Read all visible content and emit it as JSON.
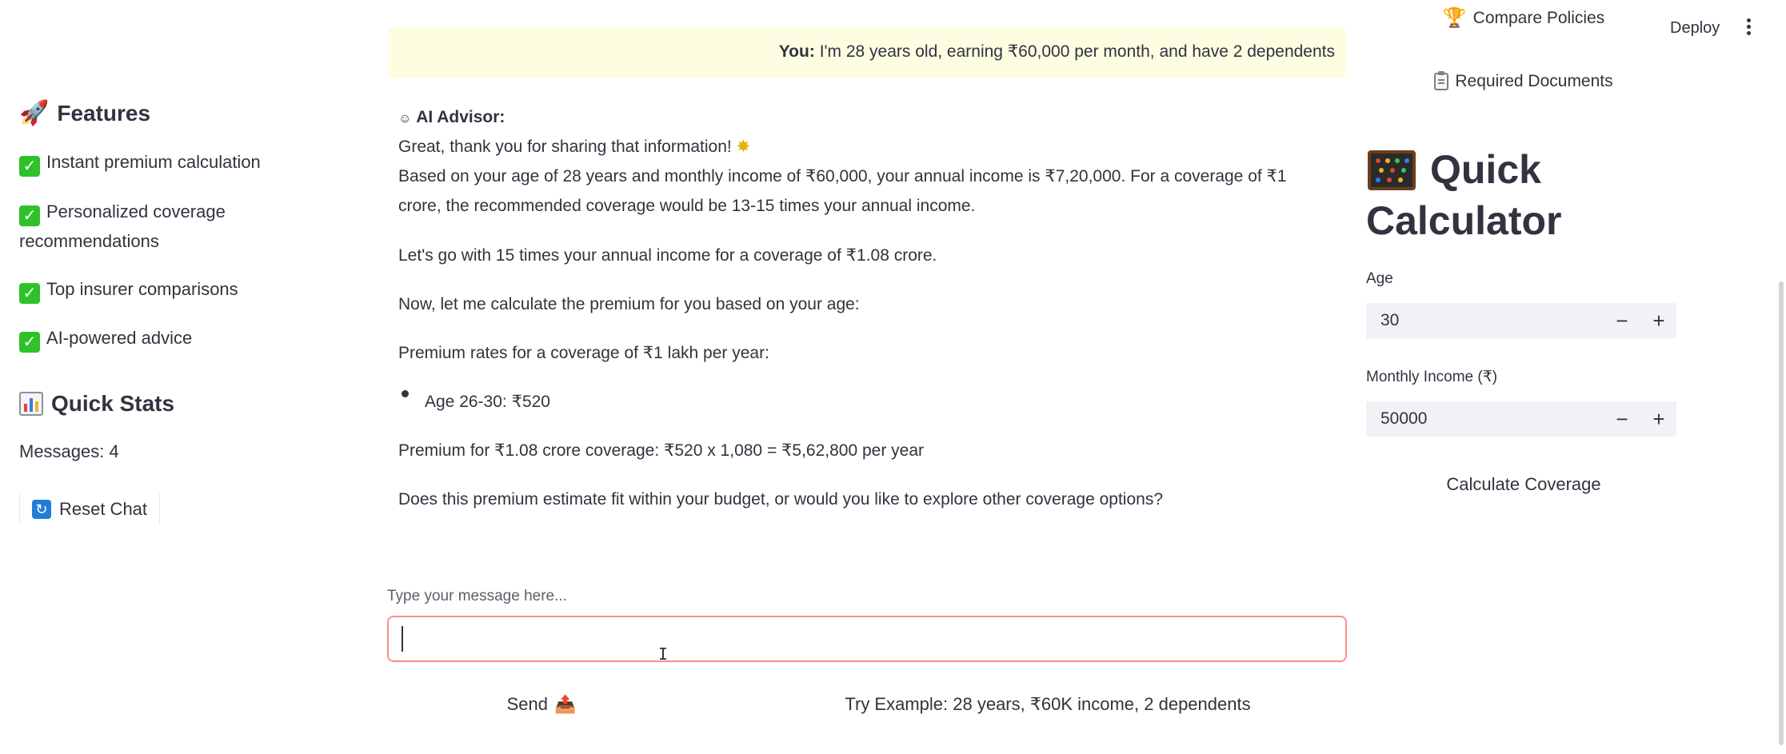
{
  "header": {
    "deploy_label": "Deploy"
  },
  "sidebar": {
    "features_heading": "Features",
    "features": [
      "Instant premium calculation",
      "Personalized coverage recommendations",
      "Top insurer comparisons",
      "AI-powered advice"
    ],
    "stats_heading": "Quick Stats",
    "messages_text": "Messages: 4",
    "reset_label": "Reset Chat"
  },
  "chat": {
    "user_prefix": "You:",
    "user_text": "I'm 28 years old, earning ₹60,000 per month, and have 2 dependents",
    "ai_icon": "☺",
    "ai_name": "AI Advisor:",
    "ai_greeting": "Great, thank you for sharing that information!",
    "ai_p1": "Based on your age of 28 years and monthly income of ₹60,000, your annual income is ₹7,20,000. For a coverage of ₹1 crore, the recommended coverage would be 13-15 times your annual income.",
    "ai_p2": "Let's go with 15 times your annual income for a coverage of ₹1.08 crore.",
    "ai_p3": "Now, let me calculate the premium for you based on your age:",
    "ai_p4": "Premium rates for a coverage of ₹1 lakh per year:",
    "ai_bullet": "Age 26-30: ₹520",
    "ai_p5": "Premium for ₹1.08 crore coverage: ₹520 x 1,080 = ₹5,62,800 per year",
    "ai_p6": "Does this premium estimate fit within your budget, or would you like to explore other coverage options?",
    "input_label": "Type your message here...",
    "input_value": "",
    "send_label": "Send",
    "example_label": "Try Example: 28 years, ₹60K income, 2 dependents"
  },
  "right": {
    "compare_label": "Compare Policies",
    "docs_label": "Required Documents",
    "calc_title_line1": "Quick",
    "calc_title_line2": "Calculator",
    "age_label": "Age",
    "age_value": "30",
    "income_label": "Monthly Income (₹)",
    "income_value": "50000",
    "calc_button": "Calculate Coverage",
    "minus": "−",
    "plus": "+"
  },
  "icons": {
    "features": "rocket-icon",
    "check": "check-mark-icon",
    "stats": "bar-chart-icon",
    "reset": "refresh-icon",
    "send": "outbox-tray-icon",
    "compare": "trophy-icon",
    "docs": "clipboard-icon",
    "calculator": "abacus-icon"
  },
  "colors": {
    "user_bubble": "#fdfde2",
    "input_border": "#ff8b8b",
    "check_green": "#2ec22a",
    "input_bg": "#f0f2f6"
  }
}
